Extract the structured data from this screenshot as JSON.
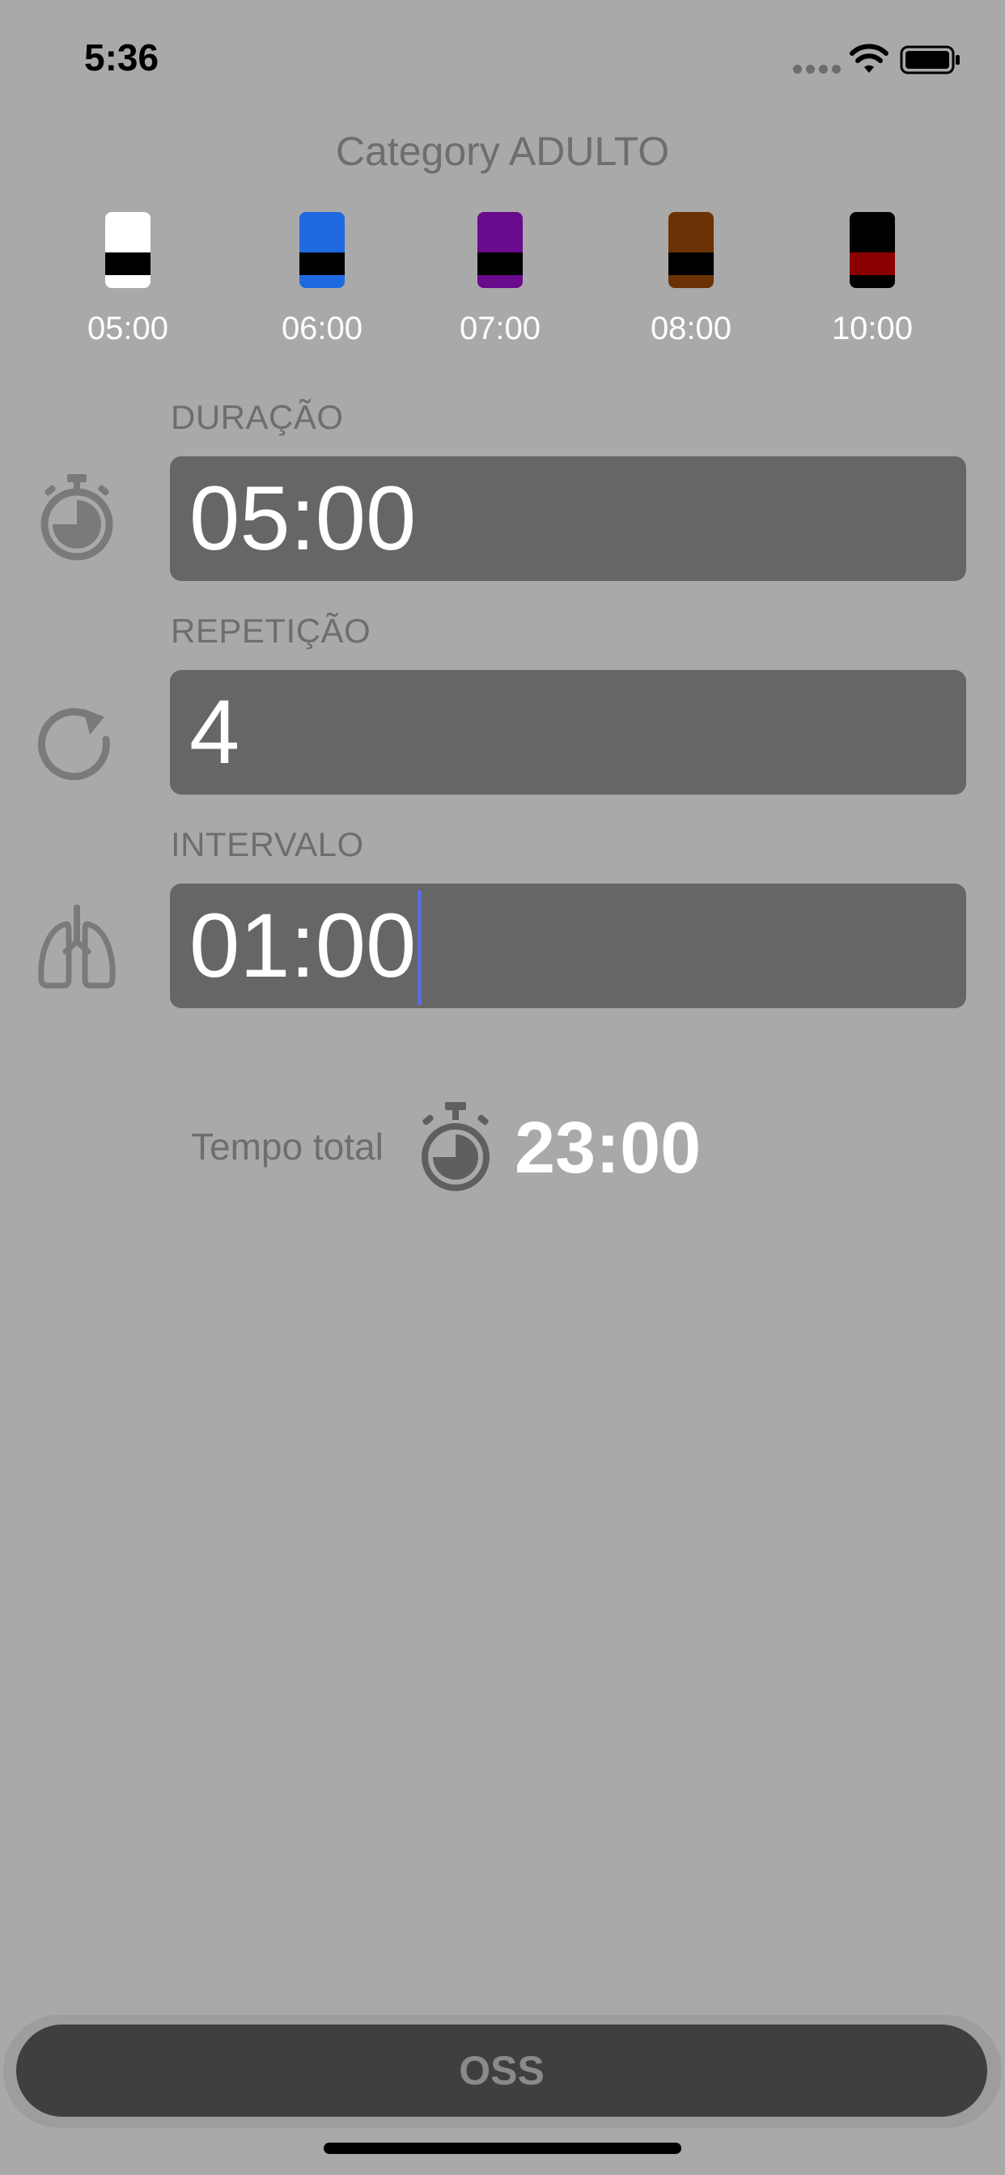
{
  "status_bar": {
    "time": "5:36"
  },
  "category": {
    "title": "Category ADULTO"
  },
  "belts": [
    {
      "label": "05:00",
      "color": "#ffffff",
      "stripe": "#000000"
    },
    {
      "label": "06:00",
      "color": "#1f6ae0",
      "stripe": "#000000"
    },
    {
      "label": "07:00",
      "color": "#6a0a8c",
      "stripe": "#000000"
    },
    {
      "label": "08:00",
      "color": "#6b3305",
      "stripe": "#000000"
    },
    {
      "label": "10:00",
      "color": "#000000",
      "stripe": "#8a0000"
    }
  ],
  "duracao": {
    "label": "DURAÇÃO",
    "value": "05:00",
    "icon": "stopwatch-icon"
  },
  "repeticao": {
    "label": "REPETIÇÃO",
    "value": "4",
    "icon": "refresh-icon"
  },
  "intervalo": {
    "label": "INTERVALO",
    "value": "01:00",
    "icon": "lungs-icon"
  },
  "total": {
    "label": "Tempo total",
    "value": "23:00",
    "icon": "stopwatch-icon"
  },
  "action": {
    "label": "OSS"
  }
}
